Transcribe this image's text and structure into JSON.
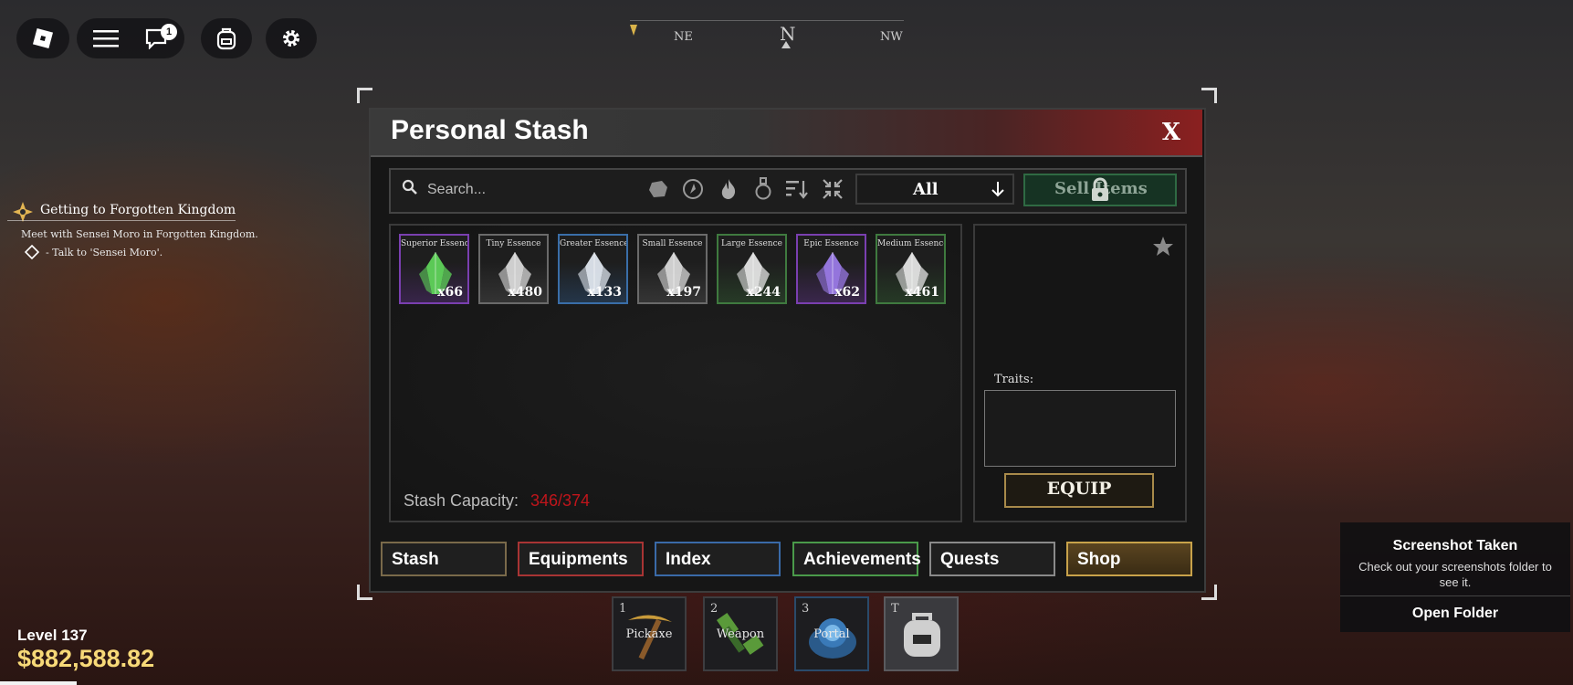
{
  "topbar": {
    "chat_badge": "1"
  },
  "compass": {
    "ne": "NE",
    "n": "N",
    "nw": "NW"
  },
  "quest": {
    "title": "Getting to Forgotten Kingdom",
    "description": "Meet with Sensei Moro in Forgotten Kingdom.",
    "objective": "- Talk to 'Sensei Moro'."
  },
  "stash": {
    "title": "Personal Stash",
    "close_label": "X",
    "search_placeholder": "Search...",
    "filter_value": "All",
    "sell_label": "Sell Items",
    "items": [
      {
        "name": "Superior Essence",
        "count": "x66",
        "rarity_color": "#7a3fb0",
        "gem_color": "#5fd35a"
      },
      {
        "name": "Tiny Essence",
        "count": "x480",
        "rarity_color": "#6a6a6a",
        "gem_color": "#d8d8d8"
      },
      {
        "name": "Greater Essence",
        "count": "x133",
        "rarity_color": "#3a6ea8",
        "gem_color": "#dfe6ee"
      },
      {
        "name": "Small Essence",
        "count": "x197",
        "rarity_color": "#6a6a6a",
        "gem_color": "#d8d8d8"
      },
      {
        "name": "Large Essence",
        "count": "x244",
        "rarity_color": "#3f7a3f",
        "gem_color": "#e4e4e4"
      },
      {
        "name": "Epic Essence",
        "count": "x62",
        "rarity_color": "#7a3fb0",
        "gem_color": "#9a7ae6"
      },
      {
        "name": "Medium Essence",
        "count": "x461",
        "rarity_color": "#3f7a3f",
        "gem_color": "#e4e4e4"
      }
    ],
    "capacity_label": "Stash Capacity:",
    "capacity_value": "346/374",
    "traits_label": "Traits:",
    "equip_label": "EQUIP"
  },
  "tabs": [
    {
      "label": "Stash",
      "border": "#7a6a4a"
    },
    {
      "label": "Equipments",
      "border": "#a83434"
    },
    {
      "label": "Index",
      "border": "#3a6aa8"
    },
    {
      "label": "Achievements",
      "border": "#4a9a4a"
    },
    {
      "label": "Quests",
      "border": "#8a8a8a"
    },
    {
      "label": "Shop",
      "border": "#c8a24a"
    }
  ],
  "hotbar": [
    {
      "key": "1",
      "label": "Pickaxe"
    },
    {
      "key": "2",
      "label": "Weapon"
    },
    {
      "key": "3",
      "label": "Portal"
    },
    {
      "key": "T",
      "label": ""
    }
  ],
  "toast": {
    "title": "Screenshot Taken",
    "body": "Check out your screenshots folder to see it.",
    "button": "Open Folder"
  },
  "player": {
    "level": "Level 137",
    "money": "$882,588.82"
  }
}
